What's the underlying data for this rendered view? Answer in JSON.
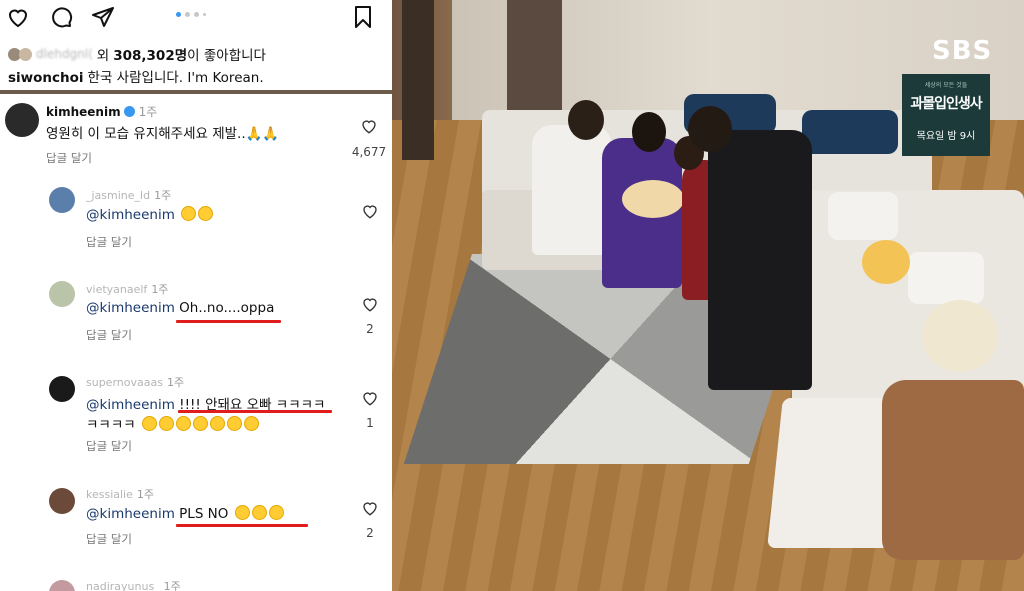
{
  "post": {
    "liker_name": "dlehdgnl(",
    "likes_text_prefix": "외",
    "likes_count": "308,302명",
    "likes_text_suffix": "이 좋아합니다",
    "caption_user": "siwonchoi",
    "caption_text": "한국 사람입니다. I'm Korean."
  },
  "comments": [
    {
      "user": "kimheenim",
      "time": "1주",
      "verified": true,
      "text": "영원히 이 모습 유지해주세요 제발..🙏🙏",
      "reply": "답글 달기",
      "likes": "4,677"
    },
    {
      "user": "_jasmine_ld",
      "time": "1주",
      "mention": "@kimheenim",
      "text": "",
      "reply": "답글 달기",
      "likes": ""
    },
    {
      "user": "vietyanaelf",
      "time": "1주",
      "mention": "@kimheenim",
      "text": "Oh..no....oppa",
      "reply": "답글 달기",
      "likes": "2"
    },
    {
      "user": "supernovaaas",
      "time": "1주",
      "mention": "@kimheenim",
      "text": "!!!! 안돼요 오빠 ㅋㅋㅋㅋ",
      "text2": "ㅋㅋㅋㅋ",
      "reply": "답글 달기",
      "likes": "1"
    },
    {
      "user": "kessialie",
      "time": "1주",
      "mention": "@kimheenim",
      "text": "PLS NO",
      "reply": "답글 달기",
      "likes": "2"
    },
    {
      "user": "nadirayunus_",
      "time": "1주"
    }
  ],
  "broadcast": {
    "network": "SBS",
    "show_top": "세상의 모든 것들",
    "show_title": "과몰입인생사",
    "air_time": "목요일 밤 9시"
  },
  "colors": {
    "accent": "#3897f0",
    "underline": "#e01c1c",
    "banner": "#1d3a3a"
  }
}
